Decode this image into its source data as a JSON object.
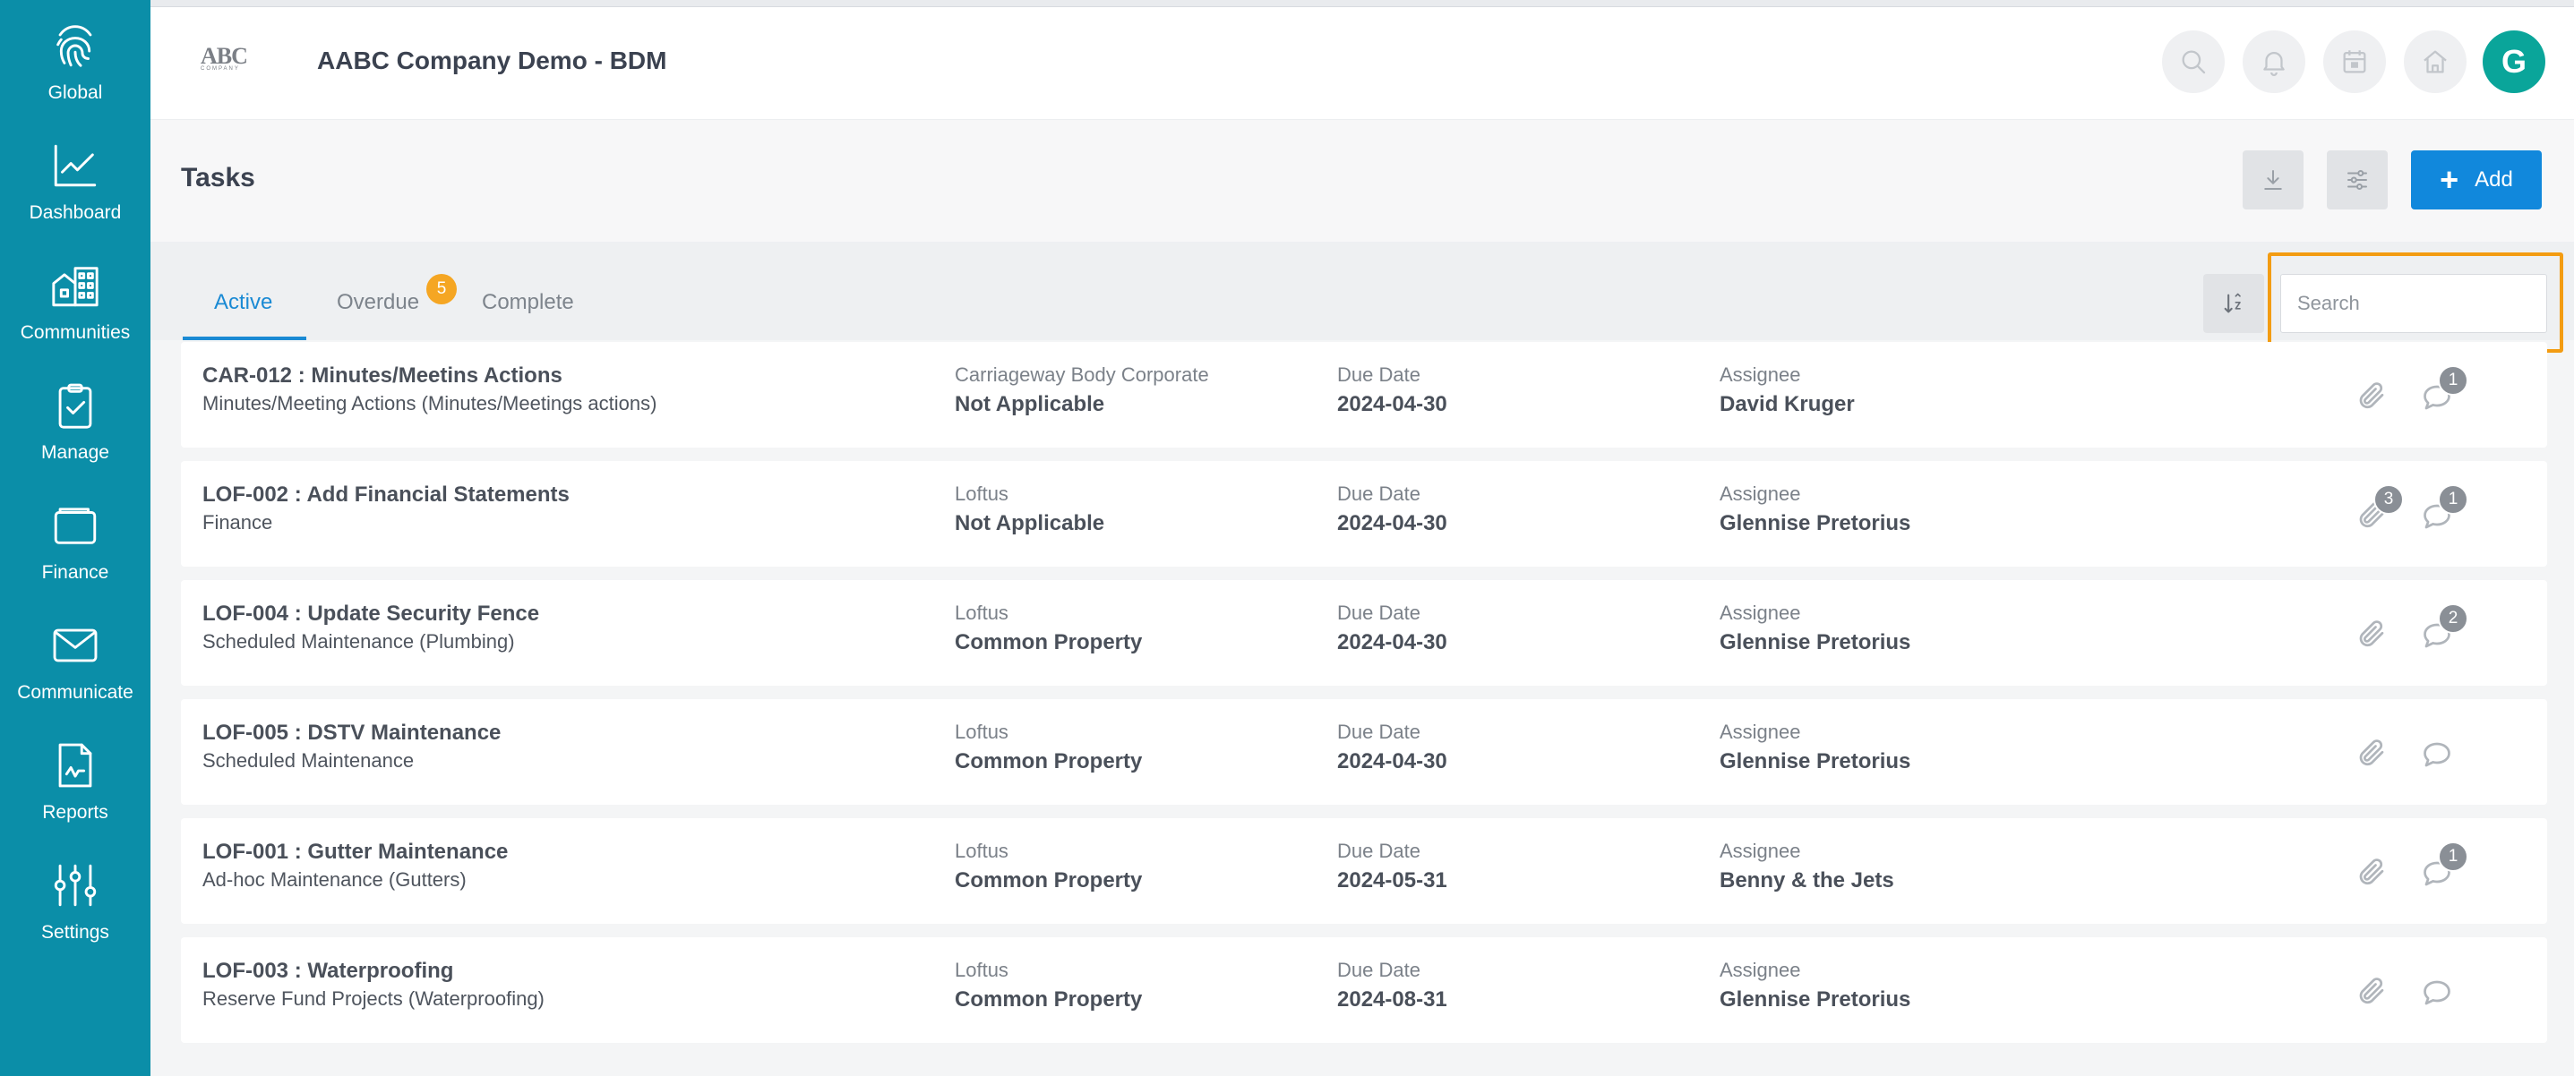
{
  "sidebar": {
    "items": [
      {
        "label": "Global",
        "icon": "fingerprint-icon"
      },
      {
        "label": "Dashboard",
        "icon": "line-chart-icon"
      },
      {
        "label": "Communities",
        "icon": "buildings-icon"
      },
      {
        "label": "Manage",
        "icon": "clipboard-check-icon"
      },
      {
        "label": "Finance",
        "icon": "wallet-icon"
      },
      {
        "label": "Communicate",
        "icon": "envelope-icon"
      },
      {
        "label": "Reports",
        "icon": "report-icon"
      },
      {
        "label": "Settings",
        "icon": "sliders-icon"
      }
    ]
  },
  "header": {
    "logo_text": "ABC",
    "logo_subtext": "COMPANY",
    "company": "AABC Company Demo - BDM",
    "avatar_initial": "G"
  },
  "page": {
    "title": "Tasks",
    "add_label": "Add"
  },
  "tabs": {
    "active": "Active",
    "overdue": "Overdue",
    "overdue_count": "5",
    "complete": "Complete"
  },
  "search": {
    "placeholder": "Search",
    "value": ""
  },
  "colors": {
    "sidebar": "#0b8ea8",
    "accent": "#1188dc",
    "badge": "#f5a623",
    "highlight": "#f39c12",
    "avatar": "#0aa59a"
  },
  "tasks": [
    {
      "title": "CAR-012 : Minutes/Meetins Actions",
      "subtitle": "Minutes/Meeting Actions (Minutes/Meetings actions)",
      "community": "Carriageway Body Corporate",
      "location": "Not Applicable",
      "due_label": "Due Date",
      "due": "2024-04-30",
      "assignee_label": "Assignee",
      "assignee": "David Kruger",
      "attachments": "",
      "comments": "1"
    },
    {
      "title": "LOF-002 : Add Financial Statements",
      "subtitle": "Finance",
      "community": "Loftus",
      "location": "Not Applicable",
      "due_label": "Due Date",
      "due": "2024-04-30",
      "assignee_label": "Assignee",
      "assignee": "Glennise Pretorius",
      "attachments": "3",
      "comments": "1"
    },
    {
      "title": "LOF-004 : Update Security Fence",
      "subtitle": "Scheduled Maintenance (Plumbing)",
      "community": "Loftus",
      "location": "Common Property",
      "due_label": "Due Date",
      "due": "2024-04-30",
      "assignee_label": "Assignee",
      "assignee": "Glennise Pretorius",
      "attachments": "",
      "comments": "2"
    },
    {
      "title": "LOF-005 : DSTV Maintenance",
      "subtitle": "Scheduled Maintenance",
      "community": "Loftus",
      "location": "Common Property",
      "due_label": "Due Date",
      "due": "2024-04-30",
      "assignee_label": "Assignee",
      "assignee": "Glennise Pretorius",
      "attachments": "",
      "comments": ""
    },
    {
      "title": "LOF-001 : Gutter Maintenance",
      "subtitle": "Ad-hoc Maintenance (Gutters)",
      "community": "Loftus",
      "location": "Common Property",
      "due_label": "Due Date",
      "due": "2024-05-31",
      "assignee_label": "Assignee",
      "assignee": "Benny & the Jets",
      "attachments": "",
      "comments": "1"
    },
    {
      "title": "LOF-003 : Waterproofing",
      "subtitle": "Reserve Fund Projects (Waterproofing)",
      "community": "Loftus",
      "location": "Common Property",
      "due_label": "Due Date",
      "due": "2024-08-31",
      "assignee_label": "Assignee",
      "assignee": "Glennise Pretorius",
      "attachments": "",
      "comments": ""
    }
  ]
}
